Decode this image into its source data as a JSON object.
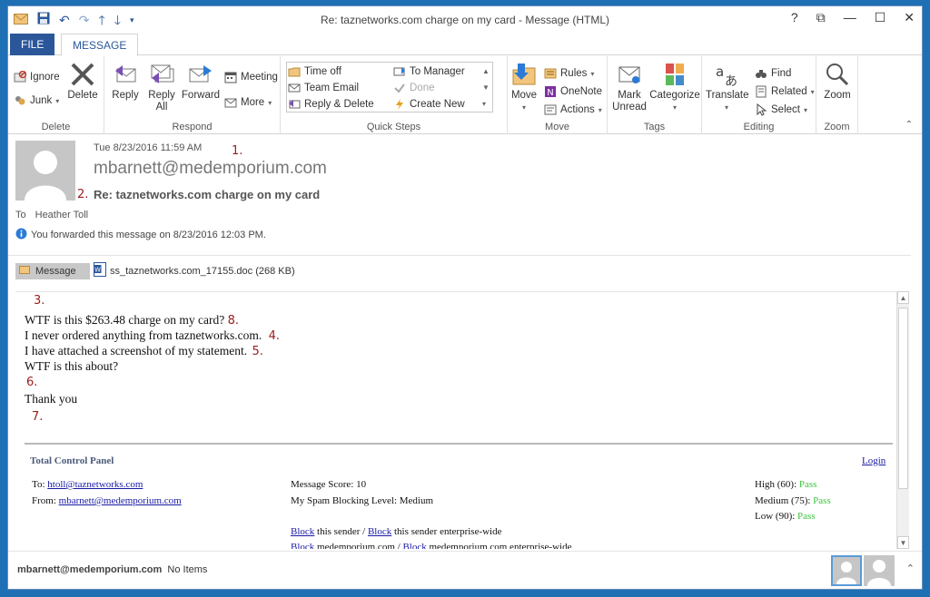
{
  "window": {
    "title": "Re: taznetworks.com charge on my card - Message (HTML)",
    "controls": [
      "?",
      "⧉",
      "—",
      "☐",
      "✕"
    ]
  },
  "tabs": [
    {
      "label": "FILE"
    },
    {
      "label": "MESSAGE"
    }
  ],
  "ribbon": {
    "delete_group": {
      "label": "Delete",
      "ignore": "Ignore",
      "junk": "Junk",
      "delete": "Delete"
    },
    "respond_group": {
      "label": "Respond",
      "reply": "Reply",
      "reply_all_1": "Reply",
      "reply_all_2": "All",
      "forward": "Forward",
      "meeting": "Meeting",
      "more": "More"
    },
    "quicksteps_group": {
      "label": "Quick Steps",
      "items": [
        "Time off",
        "Team Email",
        "Reply & Delete",
        "To Manager",
        "Done",
        "Create New"
      ]
    },
    "move_group": {
      "label": "Move",
      "move": "Move",
      "rules": "Rules",
      "onenote": "OneNote",
      "actions": "Actions"
    },
    "tags_group": {
      "label": "Tags",
      "mark_unread_1": "Mark",
      "mark_unread_2": "Unread",
      "categorize": "Categorize"
    },
    "editing_group": {
      "label": "Editing",
      "translate": "Translate",
      "find": "Find",
      "related": "Related",
      "select": "Select"
    },
    "zoom_group": {
      "label": "Zoom",
      "zoom": "Zoom"
    }
  },
  "header": {
    "date": "Tue 8/23/2016 11:59 AM",
    "sender": "mbarnett@medemporium.com",
    "subject": "Re: taznetworks.com charge on my card",
    "to_label": "To",
    "to_name": "Heather Toll",
    "forward_notice": "You forwarded this message on 8/23/2016 12:03 PM.",
    "attachment_tab": "Message",
    "attachment_file": "ss_taznetworks.com_17155.doc (268 KB)"
  },
  "annotations": [
    "1.",
    "2.",
    "3.",
    "4.",
    "5.",
    "6.",
    "7.",
    "8."
  ],
  "body": {
    "lines": [
      "WTF is this $263.48 charge on my card?",
      "I never ordered anything from taznetworks.com.",
      "I have attached a screenshot of my statement.",
      "WTF is this about?"
    ],
    "closing": "Thank you"
  },
  "control_panel": {
    "title": "Total Control Panel",
    "login": "Login",
    "to_label": "To:",
    "to_addr": "htoll@taznetworks.com",
    "from_label": "From:",
    "from_addr": "mbarnett@medemporium.com",
    "score": "Message Score: 10",
    "level": "My Spam Blocking Level: Medium",
    "high": "High (60):",
    "medium": "Medium (75):",
    "low": "Low (90):",
    "pass": "Pass",
    "block": "Block",
    "block_sender_mid": "this sender /",
    "block_sender_end": "this sender enterprise-wide",
    "block_domain_mid": "medemporium.com /",
    "block_domain_end": "medemporium.com enterprise-wide"
  },
  "status": {
    "sender": "mbarnett@medemporium.com",
    "items": "No Items"
  }
}
